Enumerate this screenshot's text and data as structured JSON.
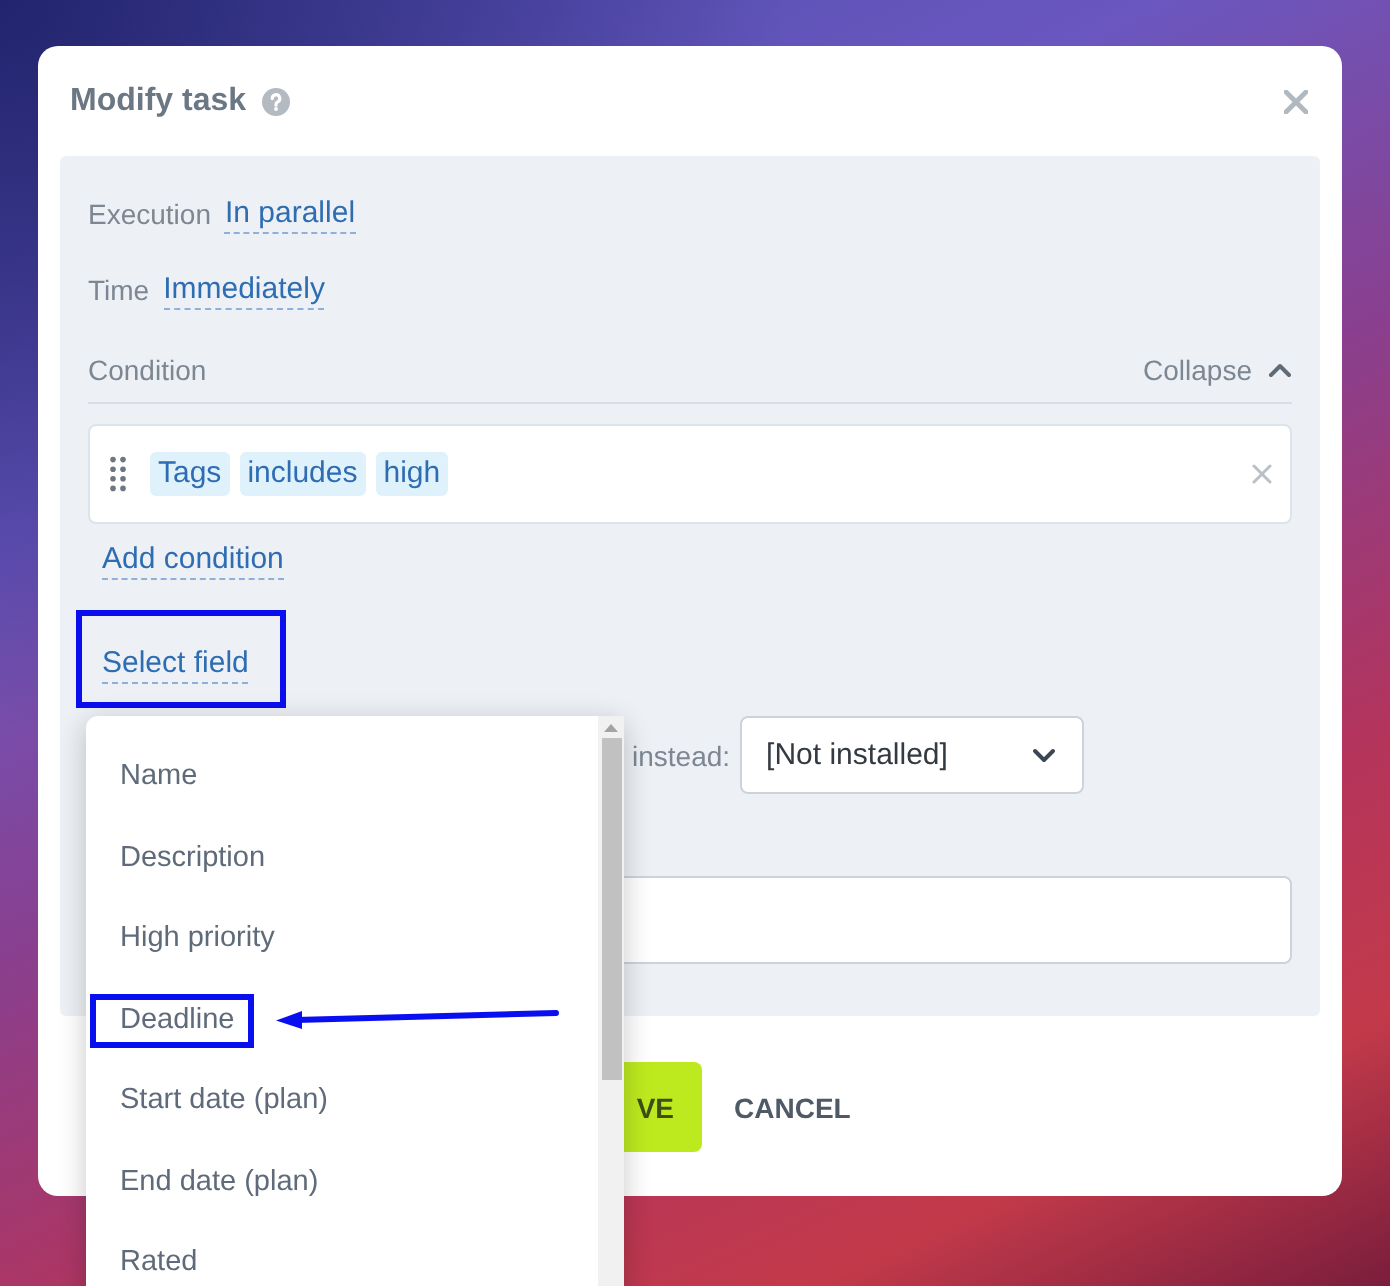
{
  "dialog": {
    "title": "Modify task"
  },
  "settings": [
    {
      "label": "Execution",
      "value": "In parallel"
    },
    {
      "label": "Time",
      "value": "Immediately"
    }
  ],
  "condition": {
    "label": "Condition",
    "toggle": "Collapse",
    "expanded": true,
    "rules": [
      {
        "tokens": [
          "Tags",
          "includes",
          "high"
        ]
      }
    ],
    "add_link": "Add condition"
  },
  "select_field": {
    "label": "Select field",
    "annotated": true
  },
  "fallback": {
    "label": "instead:",
    "value": "[Not installed]"
  },
  "buttons": [
    {
      "kind": "primary",
      "label": "VE"
    },
    {
      "kind": "secondary",
      "label": "CANCEL"
    }
  ],
  "field_menu": {
    "items": [
      {
        "label": "Name",
        "annotated": false
      },
      {
        "label": "Description",
        "annotated": false
      },
      {
        "label": "High priority",
        "annotated": false
      },
      {
        "label": "Deadline",
        "annotated": true
      },
      {
        "label": "Start date (plan)",
        "annotated": false
      },
      {
        "label": "End date (plan)",
        "annotated": false
      },
      {
        "label": "Rated",
        "annotated": false
      }
    ]
  }
}
